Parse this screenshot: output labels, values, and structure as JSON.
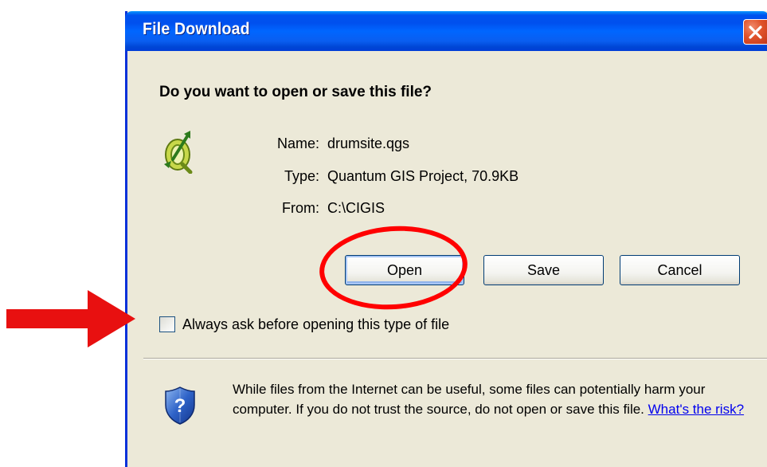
{
  "window": {
    "title": "File Download"
  },
  "dialog": {
    "question": "Do you want to open or save this file?",
    "file": {
      "icon": "qgis-project-icon",
      "name_label": "Name:",
      "name_value": "drumsite.qgs",
      "type_label": "Type:",
      "type_value": "Quantum GIS Project, 70.9KB",
      "from_label": "From:",
      "from_value": "C:\\CIGIS"
    },
    "buttons": {
      "open": "Open",
      "save": "Save",
      "cancel": "Cancel"
    },
    "checkbox": {
      "label": "Always ask before opening this type of file",
      "checked": false
    },
    "warning": {
      "icon": "security-shield-icon",
      "text": "While files from the Internet can be useful, some files can potentially harm your computer. If you do not trust the source, do not open or save this file.",
      "link": "What's the risk?"
    }
  },
  "annotations": {
    "highlight_color": "#ff0000",
    "arrow_color": "#e81010"
  },
  "colors": {
    "titlebar": "#0058ee",
    "dialog_bg": "#ece9d8",
    "close_button": "#e0532b",
    "link": "#0000ee"
  }
}
